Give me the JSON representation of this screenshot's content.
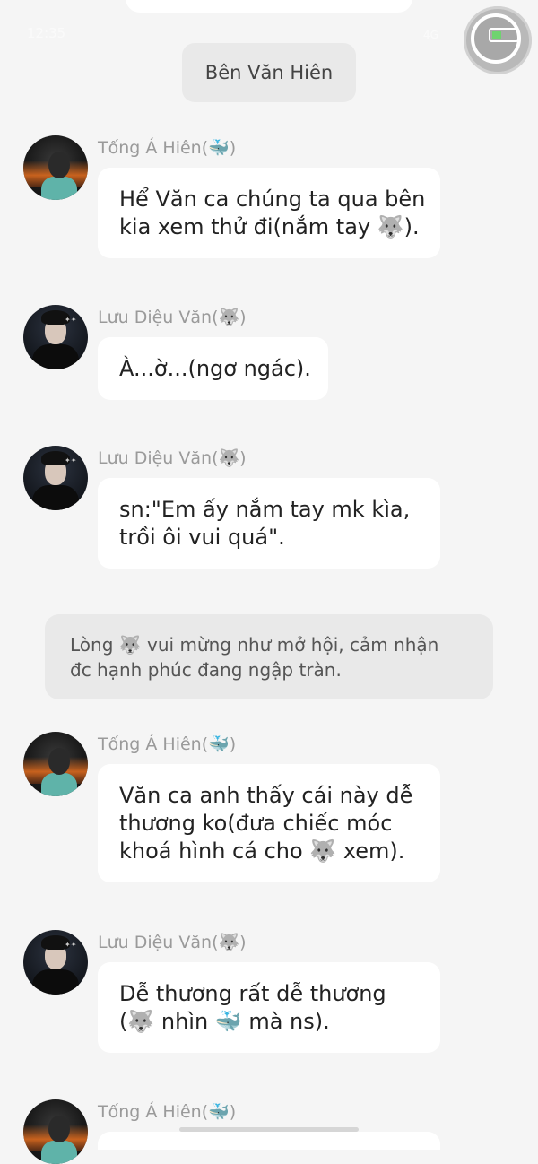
{
  "status": {
    "time": "12:35",
    "signal": "4G"
  },
  "narration_header": "Bên Văn Hiên",
  "messages": [
    {
      "sender": "Tống Á Hiên(🐳)",
      "lines": [
        "Hể Văn ca chúng ta qua bên",
        "kia xem thử đi(nắm tay 🐺)."
      ]
    },
    {
      "sender": "Lưu Diệu Văn(🐺)",
      "lines": [
        "À...ờ...(ngơ ngác)."
      ]
    },
    {
      "sender": "Lưu Diệu Văn(🐺)",
      "lines": [
        "sn:\"Em ấy nắm tay mk kìa,",
        "trồi ôi vui quá\"."
      ]
    },
    {
      "sender": "Tống Á Hiên(🐳)",
      "lines": [
        "Văn ca anh thấy cái này dễ",
        "thương ko(đưa chiếc móc",
        "khoá hình cá cho 🐺 xem)."
      ]
    },
    {
      "sender": "Lưu Diệu Văn(🐺)",
      "lines": [
        "Dễ thương rất dễ thương",
        "(🐺 nhìn 🐳 mà ns)."
      ]
    },
    {
      "sender": "Tống Á Hiên(🐳)",
      "lines": []
    }
  ],
  "narration_box": {
    "lines": [
      "Lòng 🐺 vui mừng như mở hội, cảm nhận",
      "đc hạnh phúc đang ngập tràn."
    ]
  },
  "colors": {
    "background": "#f5f5f5",
    "bubble": "#ffffff",
    "narration": "#e9e9e9",
    "name": "#9a9a9a"
  }
}
